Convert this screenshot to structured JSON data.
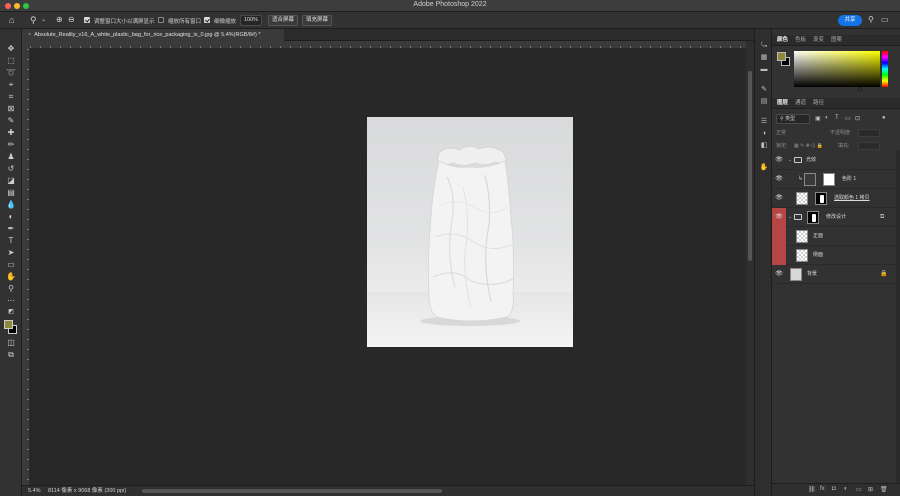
{
  "window": {
    "title": "Adobe Photoshop 2022"
  },
  "options_bar": {
    "resize_windows_label": "调整窗口大小以满屏显示",
    "zoom_all_windows_label": "缩放所有窗口",
    "scrubby_zoom_label": "细微缩放",
    "zoom_value": "100%",
    "fit_screen_label": "适合屏幕",
    "fill_screen_label": "填充屏幕",
    "share_label": "共享"
  },
  "document": {
    "tab_title": "Absolute_Reality_v16_A_white_plastic_bag_for_rice_packaging_is_0.jpg @ 5.4%(RGB/8#) *",
    "close_glyph": "×"
  },
  "status_bar": {
    "zoom": "5.4%",
    "doc_info": "8114 像素 x 9068 像素 (300 ppi)"
  },
  "color_panel": {
    "tabs": [
      "颜色",
      "色板",
      "渐变",
      "图案"
    ],
    "foreground_color": "#8a8a3a",
    "background_color": "#000000"
  },
  "layers_panel": {
    "tabs": [
      "图层",
      "通道",
      "路径"
    ],
    "filter_label": "类型",
    "blend_mode": "正常",
    "opacity_label": "不透明度:",
    "lock_label": "锁定:",
    "fill_label": "填充:",
    "layers": [
      {
        "name": "光效",
        "kind": "group",
        "visible": true,
        "highlight": false
      },
      {
        "name": "色阶 1",
        "kind": "adjustment",
        "visible": true,
        "highlight": false
      },
      {
        "name": "选取颜色 1 拷贝",
        "kind": "adjustment",
        "visible": true,
        "highlight": false
      },
      {
        "name": "修改设计",
        "kind": "group",
        "visible": true,
        "highlight": true
      },
      {
        "name": "正面",
        "kind": "smart-object",
        "visible": false,
        "highlight": true
      },
      {
        "name": "侧面",
        "kind": "smart-object",
        "visible": false,
        "highlight": true
      },
      {
        "name": "背景",
        "kind": "background",
        "visible": true,
        "highlight": false
      }
    ]
  },
  "icons": {
    "home": "home-icon",
    "zoom": "zoom-icon",
    "zoom_in": "zoom-in-icon",
    "zoom_out": "zoom-out-icon",
    "search": "search-icon",
    "workspace": "workspace-icon",
    "share_panel": "share-panel-icon"
  }
}
